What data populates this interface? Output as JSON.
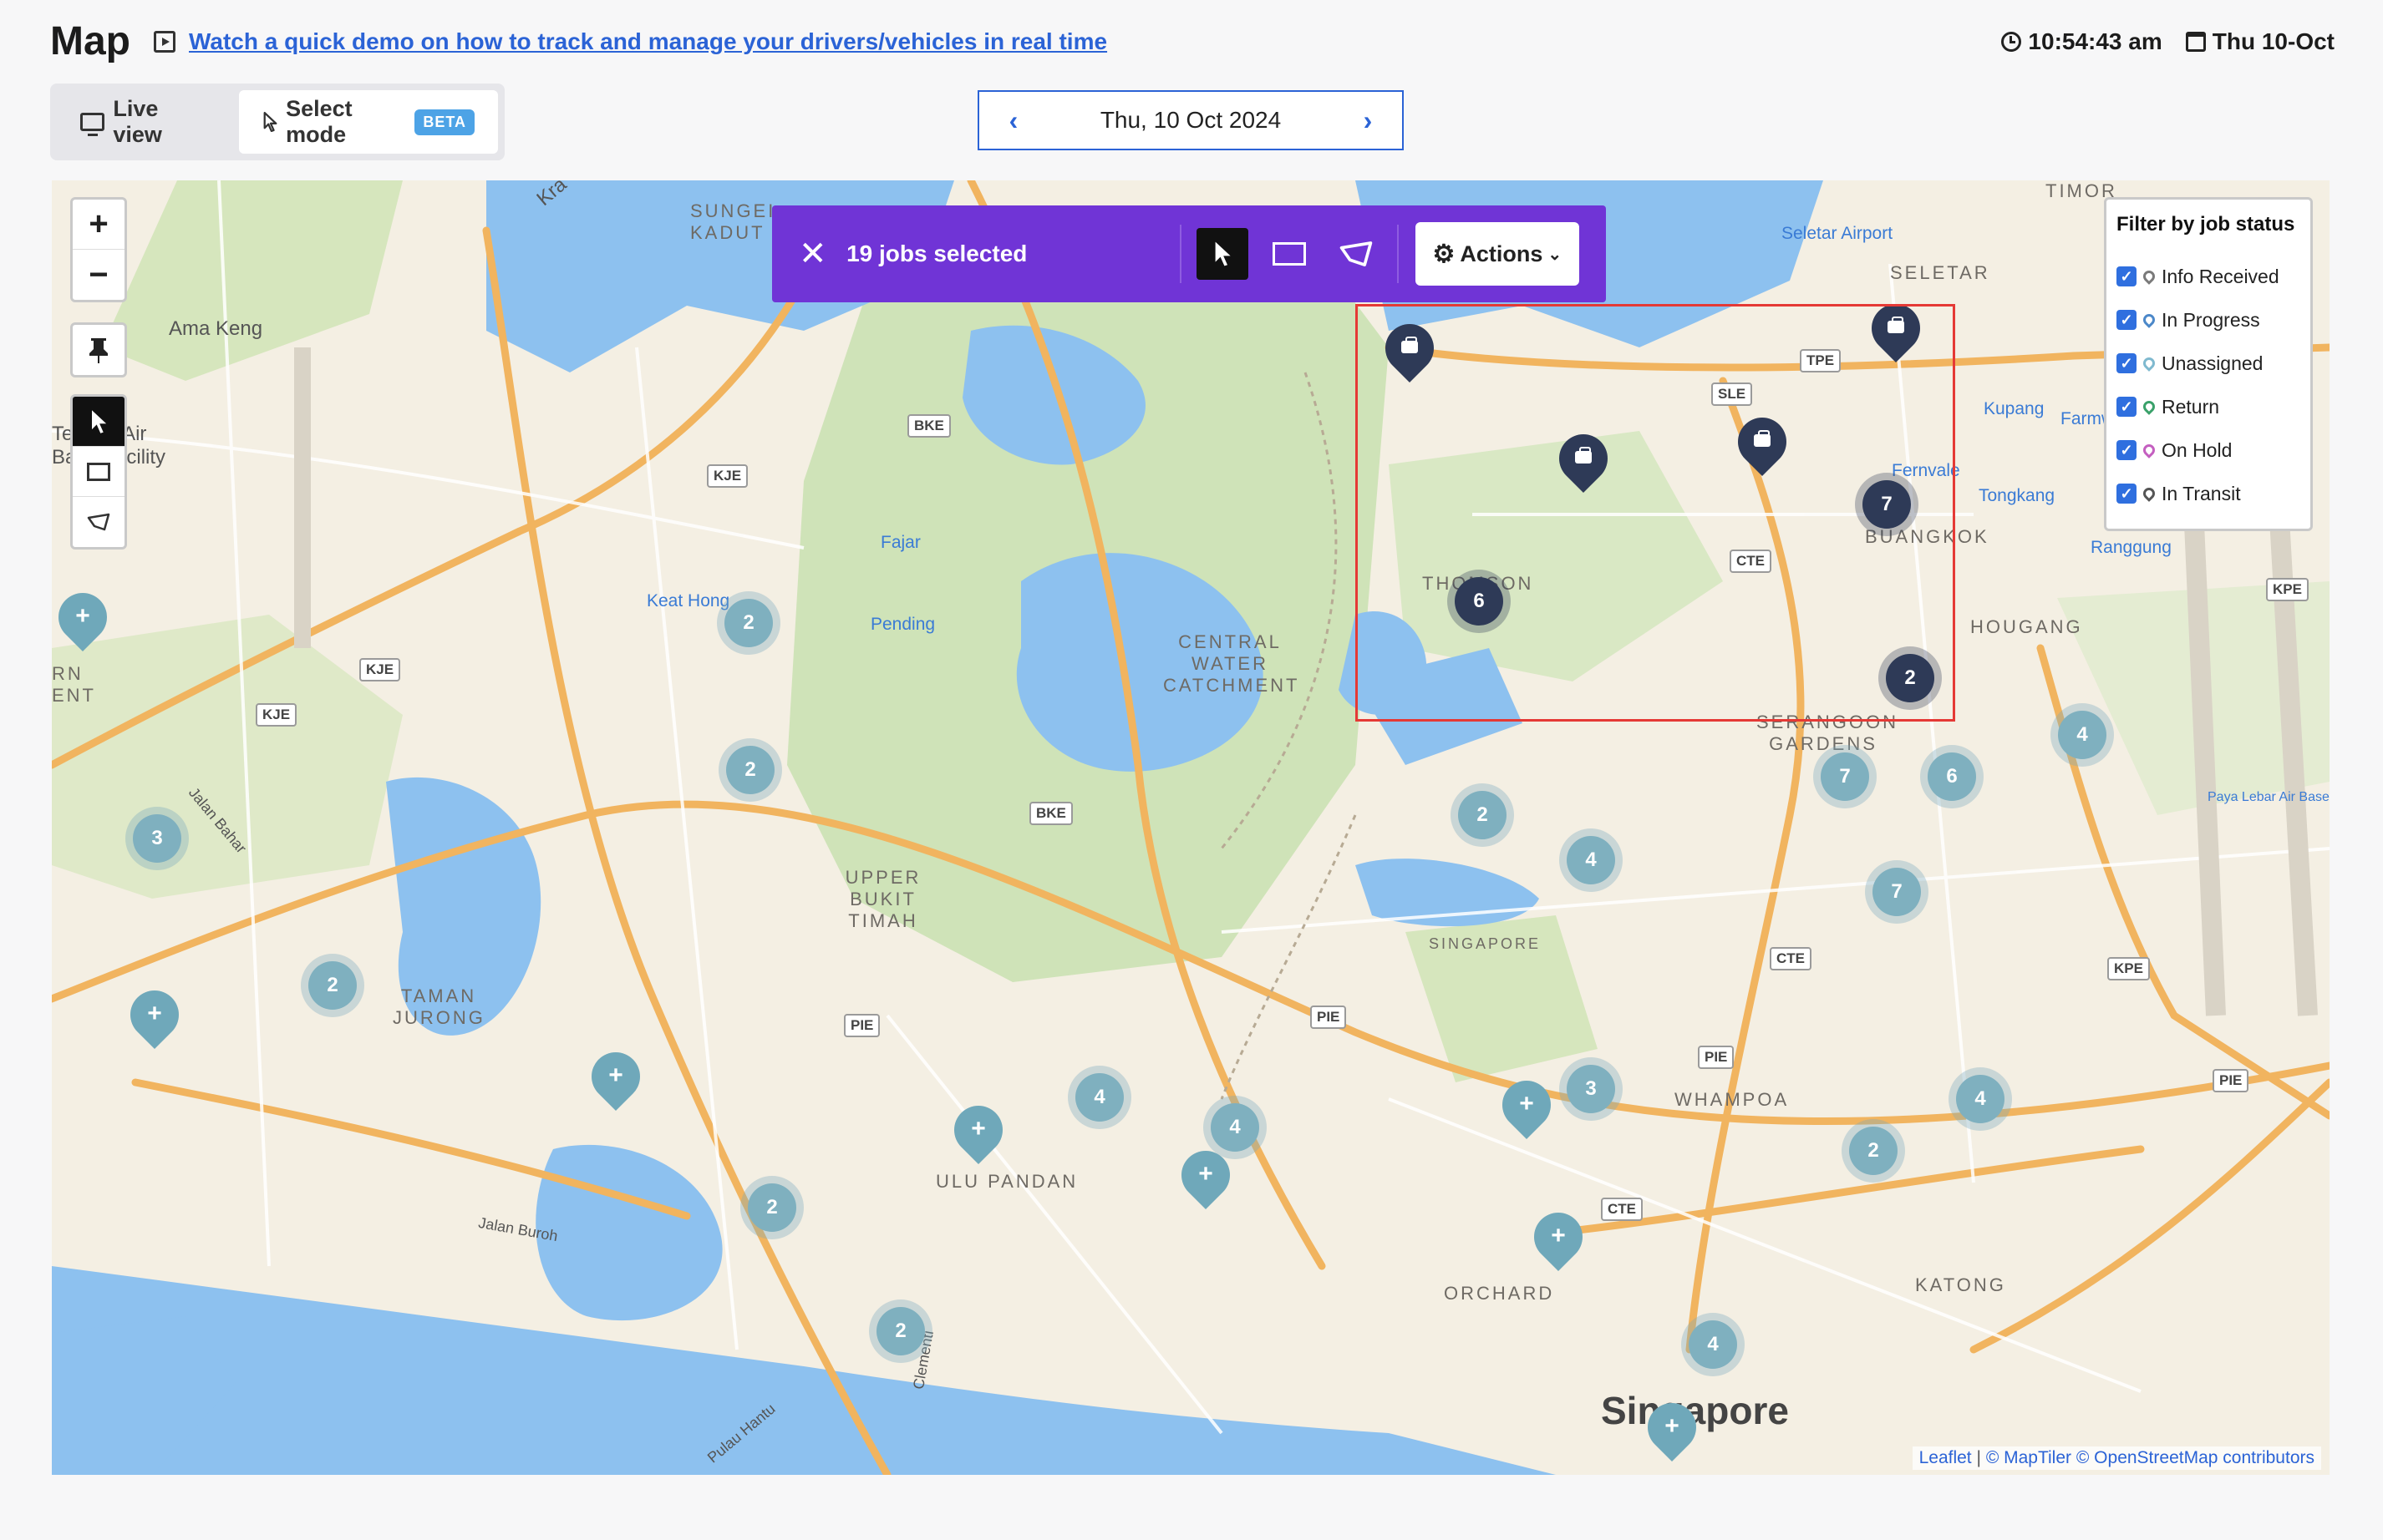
{
  "header": {
    "title": "Map",
    "demo_link": "Watch a quick demo on how to track and manage your drivers/vehicles in real time",
    "time": "10:54:43 am",
    "date": "Thu 10-Oct"
  },
  "mode_toggle": {
    "live_label": "Live view",
    "select_label": "Select mode",
    "beta_label": "BETA"
  },
  "date_nav": {
    "label": "Thu, 10 Oct 2024",
    "prev": "‹",
    "next": "›"
  },
  "selection_toolbar": {
    "count_label": "19 jobs selected",
    "actions_label": "Actions",
    "close": "✕"
  },
  "map_controls": {
    "zoom_in": "+",
    "zoom_out": "−"
  },
  "filter": {
    "title": "Filter by job status",
    "items": [
      {
        "label": "Info Received",
        "checked": true,
        "color": "#7a7a7a"
      },
      {
        "label": "In Progress",
        "checked": true,
        "color": "#4c88c9"
      },
      {
        "label": "Unassigned",
        "checked": true,
        "color": "#7fb9cf"
      },
      {
        "label": "Return",
        "checked": true,
        "color": "#3aa16a"
      },
      {
        "label": "On Hold",
        "checked": true,
        "color": "#c45fc0"
      },
      {
        "label": "In Transit",
        "checked": true,
        "color": "#555555"
      }
    ]
  },
  "map_labels": {
    "ama_keng": "Ama Keng",
    "sungei_kadut": "SUNGEI KADUT",
    "seletar_airport": "Seletar Airport",
    "seletar": "SELETAR",
    "timor": "TIMOR",
    "keat_hong": "Keat Hong",
    "fajar": "Fajar",
    "pending": "Pending",
    "central_water": "CENTRAL WATER CATCHMENT",
    "thomson": "THOMSON",
    "buangkok": "BUANGKOK",
    "hougang": "HOUGANG",
    "serangoon": "SERANGOON GARDENS",
    "kupang": "Kupang",
    "farmway": "Farmway",
    "fernvale": "Fernvale",
    "tongkang": "Tongkang",
    "rangkong": "Ranggung",
    "upper_bukit_timah": "UPPER BUKIT TIMAH",
    "singapore_small": "SINGAPORE",
    "taman_jurong": "TAMAN JURONG",
    "ulu_pandan": "ULU PANDAN",
    "whampoa": "WHAMPOA",
    "orchard": "ORCHARD",
    "katong": "KATONG",
    "singapore": "Singapore",
    "paya_lebar": "Paya Lebar Air Base",
    "jalan_bahar": "Jalan Bahar",
    "jalan_buroh": "Jalan Buroh",
    "clementi": "Clementi",
    "pulau_hantu": "Pulau Hantu",
    "kranji": "Kra",
    "rn_ent": "RN ENT",
    "tengah": "Tengah Air Base Facility"
  },
  "road_shields": [
    "BKE",
    "KJE",
    "KJE",
    "KJE",
    "BKE",
    "PIE",
    "PIE",
    "PIE",
    "CTE",
    "CTE",
    "CTE",
    "SLE",
    "TPE",
    "KPE",
    "KPE",
    "PIE"
  ],
  "clusters": [
    "2",
    "2",
    "3",
    "2",
    "2",
    "2",
    "4",
    "4",
    "2",
    "4",
    "3",
    "7",
    "6",
    "7",
    "4",
    "4",
    "2",
    "4",
    "7",
    "6",
    "2"
  ],
  "attribution": {
    "leaflet": "Leaflet",
    "sep": "|",
    "maptiler": "© MapTiler",
    "osm": "© OpenStreetMap contributors"
  }
}
